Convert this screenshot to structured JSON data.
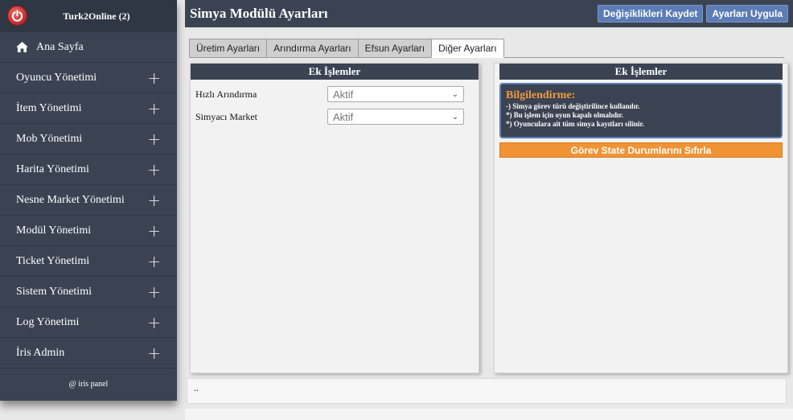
{
  "sidebar": {
    "title": "Turk2Online (2)",
    "home_label": "Ana Sayfa",
    "items": [
      {
        "label": "Oyuncu Yönetimi"
      },
      {
        "label": "İtem Yönetimi"
      },
      {
        "label": "Mob Yönetimi"
      },
      {
        "label": "Harita Yönetimi"
      },
      {
        "label": "Nesne Market Yönetimi"
      },
      {
        "label": "Modül Yönetimi"
      },
      {
        "label": "Ticket Yönetimi"
      },
      {
        "label": "Sistem Yönetimi"
      },
      {
        "label": "Log Yönetimi"
      },
      {
        "label": "İris Admin"
      }
    ],
    "footer": "@ iris panel"
  },
  "header": {
    "title": "Simya Modülü Ayarları",
    "save_label": "Değişiklikleri Kaydet",
    "apply_label": "Ayarları Uygula"
  },
  "tabs": [
    {
      "label": "Üretim Ayarları"
    },
    {
      "label": "Arındırma Ayarları"
    },
    {
      "label": "Efsun Ayarları"
    },
    {
      "label": "Diğer Ayarları"
    }
  ],
  "left_panel": {
    "title": "Ek İşlemler",
    "rows": [
      {
        "label": "Hızlı Arındırma",
        "value": "Aktif"
      },
      {
        "label": "Simyacı Market",
        "value": "Aktif"
      }
    ]
  },
  "right_panel": {
    "title": "Ek İşlemler",
    "info_title": "Bilgilendirme:",
    "info_lines": [
      "-) Simya görev türü değiştirilince kullanılır.",
      "*) Bu işlem için oyun kapalı olmalıdır.",
      "*) Oyunculara ait tüm simya kayıtları silinir."
    ],
    "reset_label": "Görev State Durumlarını Sıfırla"
  },
  "bottom": {
    "text": ".."
  },
  "colors": {
    "sidebar": "#3b4353",
    "accent_button": "#5b7cb5",
    "orange": "#ef9334"
  }
}
